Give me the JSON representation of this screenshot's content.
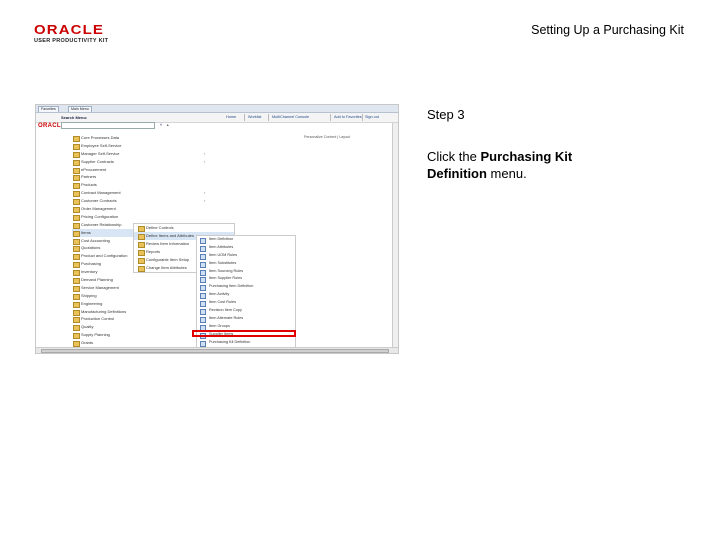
{
  "header": {
    "logo_brand": "ORACLE",
    "logo_sub": "USER PRODUCTIVITY KIT",
    "doc_title": "Setting Up a Purchasing Kit"
  },
  "step": {
    "label": "Step 3"
  },
  "instruction": {
    "prefix": "Click the ",
    "bold": "Purchasing Kit Definition",
    "suffix": " menu."
  },
  "screenshot": {
    "tabs": [
      "Favorites",
      "Main Menu"
    ],
    "app_logo": "ORACLE",
    "header_links": [
      "Home",
      "Worklist",
      "MultiChannel Console",
      "Add to Favorites",
      "Sign out"
    ],
    "favorites_label": "Personalize Content | Layout",
    "search_label": "Search Menu:",
    "search_value": "",
    "menu1": [
      "Core Processes Data",
      "Employee Self-Service",
      "Manager Self-Service",
      "Supplier Contracts",
      "eProcurement",
      "Partners",
      "Products",
      "Contract Management",
      "Customer Contracts",
      "Order Management",
      "Pricing Configuration",
      "Customer Relationship",
      "Items",
      "Cost Accounting",
      "Quotations",
      "Product and Configuration",
      "Purchasing",
      "Inventory",
      "Demand Planning",
      "Service Management",
      "Shipping",
      "Engineering",
      "Manufacturing Definitions",
      "Production Control",
      "Quality",
      "Supply Planning",
      "Grants",
      "Program Management",
      "Project Costing"
    ],
    "menu1_selected_index": 12,
    "menu2": [
      "Define Controls",
      "Define Items and Attributes",
      "Review Item Information",
      "Reports",
      "Configurable Item Setup",
      "Change Item Attributes"
    ],
    "menu2_selected_index": 1,
    "menu3": [
      "Item Definition",
      "Item Attributes",
      "Item UOM Rules",
      "Item Substitutes",
      "Item Sourcing Rules",
      "Item Supplier Rules",
      "Purchasing Item Definition",
      "Item Activity",
      "Item Cost Rules",
      "Revision Item Copy",
      "Item Alternate Rules",
      "Item Groups",
      "Supplier Items",
      "Purchasing Kit Definition"
    ],
    "menu3_highlight_index": 13
  }
}
